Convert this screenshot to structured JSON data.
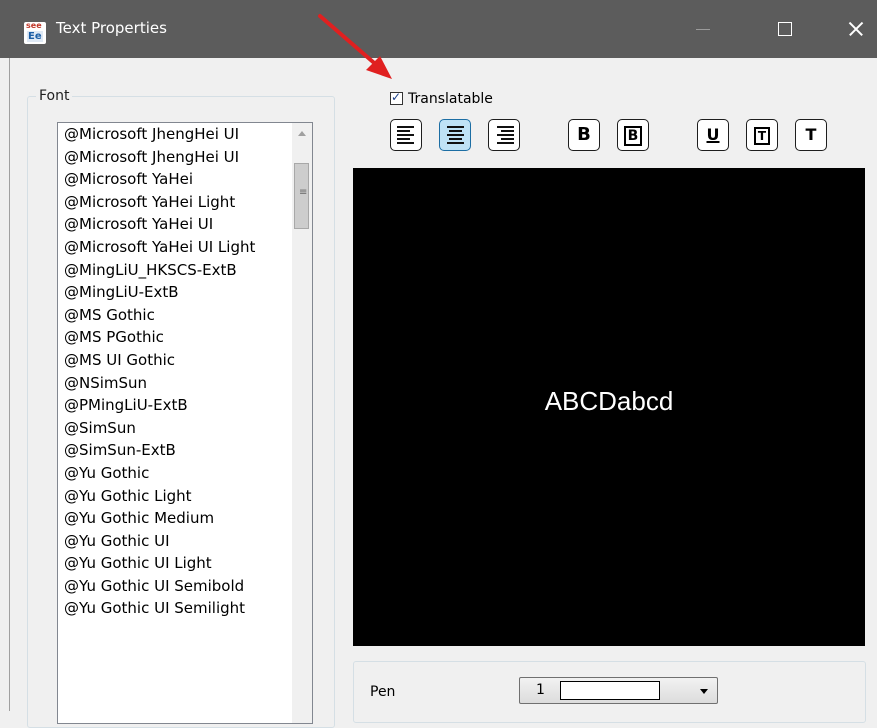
{
  "window": {
    "title": "Text Properties",
    "icon_text_top": "see",
    "icon_text_bottom": "Ee"
  },
  "font_group": {
    "legend": "Font",
    "items": [
      "@Microsoft JhengHei UI",
      "@Microsoft JhengHei UI",
      "@Microsoft YaHei",
      "@Microsoft YaHei Light",
      "@Microsoft YaHei UI",
      "@Microsoft YaHei UI Light",
      "@MingLiU_HKSCS-ExtB",
      "@MingLiU-ExtB",
      "@MS Gothic",
      "@MS PGothic",
      "@MS UI Gothic",
      "@NSimSun",
      "@PMingLiU-ExtB",
      "@SimSun",
      "@SimSun-ExtB",
      "@Yu Gothic",
      "@Yu Gothic Light",
      "@Yu Gothic Medium",
      "@Yu Gothic UI",
      "@Yu Gothic UI Light",
      "@Yu Gothic UI Semibold",
      "@Yu Gothic UI Semilight"
    ]
  },
  "translatable": {
    "label": "Translatable",
    "checked": true
  },
  "toolbar": {
    "align_left": "align-left-icon",
    "align_center": "align-center-icon",
    "align_right": "align-right-icon",
    "bold": "B",
    "bold_boxed": "B",
    "underline": "U",
    "outline": "T",
    "plain": "T",
    "active": "align-center"
  },
  "preview": {
    "text": "ABCDabcd",
    "background": "#000000",
    "foreground": "#ffffff"
  },
  "pen": {
    "label": "Pen",
    "value": "1",
    "swatch_color": "#ffffff"
  },
  "annotation": {
    "arrow_color": "#e02020"
  }
}
